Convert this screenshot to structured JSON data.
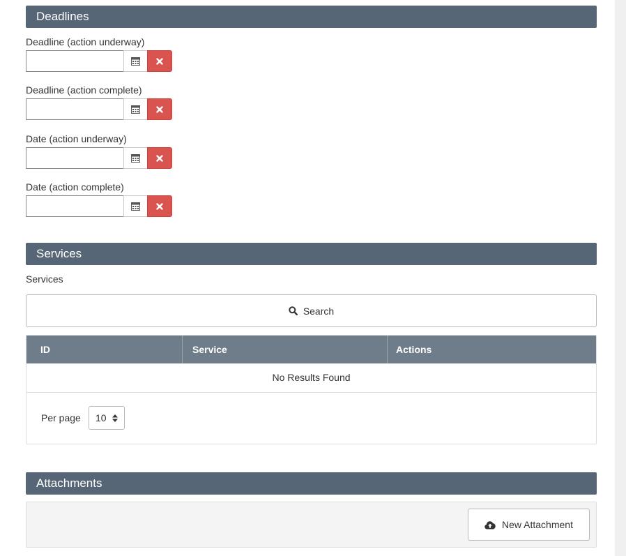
{
  "deadlines": {
    "title": "Deadlines",
    "fields": [
      {
        "label": "Deadline (action underway)",
        "value": ""
      },
      {
        "label": "Deadline (action complete)",
        "value": ""
      },
      {
        "label": "Date (action underway)",
        "value": ""
      },
      {
        "label": "Date (action complete)",
        "value": ""
      }
    ],
    "calendar_icon": "calendar-icon",
    "clear_icon": "close-icon",
    "clear_color": "#d9534f"
  },
  "services": {
    "title": "Services",
    "field_label": "Services",
    "search_label": "Search",
    "search_icon": "search-icon",
    "table": {
      "columns": [
        "ID",
        "Service",
        "Actions"
      ],
      "empty_text": "No Results Found",
      "rows": []
    },
    "per_page_label": "Per page",
    "per_page_value": "10"
  },
  "attachments": {
    "title": "Attachments",
    "new_button_label": "New Attachment",
    "new_button_icon": "cloud-upload-icon"
  },
  "colors": {
    "section_header": "#566676",
    "table_header": "#6f7d8a"
  }
}
